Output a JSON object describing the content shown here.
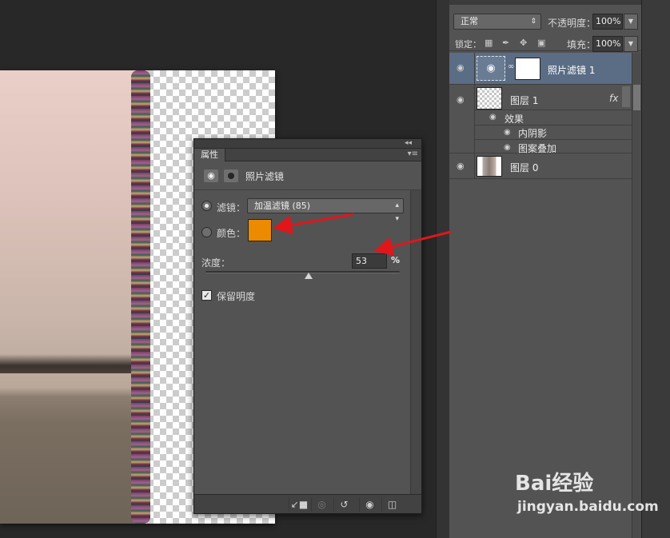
{
  "properties_panel": {
    "tab_label": "属性",
    "collapse_glyph": "◂◂",
    "menu_glyph": "▾≡",
    "title": "照片滤镜",
    "filter": {
      "label": "滤镜：",
      "value": "加温滤镜 (85)",
      "selected": true
    },
    "color": {
      "label": "颜色：",
      "swatch": "#ec8a00",
      "selected": false
    },
    "density": {
      "label": "浓度：",
      "value": "53",
      "unit": "%",
      "level": 0.53
    },
    "preserve_luminosity": {
      "label": "保留明度",
      "checked": true,
      "check_glyph": "✓"
    },
    "footer_icons": [
      "clip-to-layer-icon",
      "view-previous-icon",
      "reset-icon",
      "visibility-icon",
      "delete-icon"
    ]
  },
  "layers_panel": {
    "blend_mode": "正常",
    "opacity_label": "不透明度：",
    "opacity_value": "100%",
    "lock_label": "锁定：",
    "fill_label": "填充：",
    "fill_value": "100%",
    "layers": [
      {
        "name": "照片滤镜 1",
        "type": "adjustment",
        "selected": true
      },
      {
        "name": "图层 1",
        "type": "pixel",
        "fx": "fx",
        "effects_label": "效果",
        "effects": [
          "内阴影",
          "图案叠加"
        ]
      },
      {
        "name": "图层 0",
        "type": "pixel"
      }
    ]
  },
  "watermark": {
    "brand": "Bai经验",
    "url": "jingyan.baidu.com"
  },
  "colors": {
    "arrow_red": "#e0161b",
    "selected_layer": "#5b6d85",
    "panel_bg": "#535353"
  }
}
